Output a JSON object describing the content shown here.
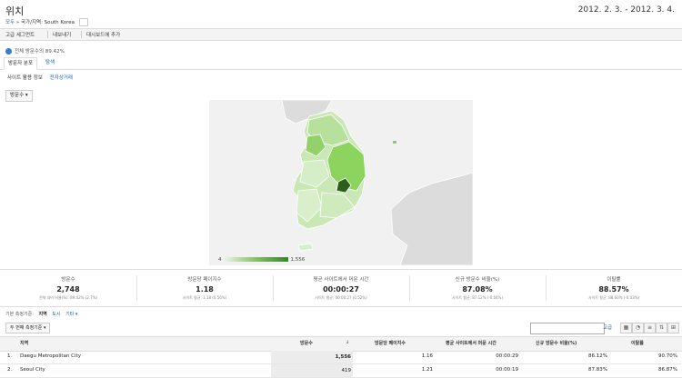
{
  "header": {
    "title": "위치",
    "date_range": "2012. 2. 3. - 2012. 3. 4."
  },
  "breadcrumb": {
    "root": "모두",
    "current": "» 국가/지역: South Korea"
  },
  "toolbar": {
    "advanced_segment": "고급 세그먼트",
    "email": "내보내기",
    "add_dashboard": "대시보드에 추가"
  },
  "segment": {
    "label": "전체 방문수의 89.42%"
  },
  "tabs": {
    "visitor_flow": "방문자 분포",
    "map_overlay": "탐색"
  },
  "subtabs": {
    "site_usage": "사이트 활용 정보",
    "goals": "전자상거래"
  },
  "metric_selector": {
    "value": "방문수"
  },
  "map_legend": {
    "min": "4",
    "max": "1,556"
  },
  "colors": {
    "map_dark": "#2d7a1c",
    "map_mid": "#8ccf63",
    "map_light": "#d9efcc",
    "link": "#1a63b8"
  },
  "metrics": [
    {
      "label": "방문수",
      "value": "2,748",
      "sub": "전체 대비 비율(%): 89.42% (2,7%)"
    },
    {
      "label": "방문당 페이지수",
      "value": "1.18",
      "sub": "사이트 평균: 1.18 (0.56%)"
    },
    {
      "label": "평균 사이트에서 머문 시간",
      "value": "00:00:27",
      "sub": "사이트 평균: 00:00:27 (0.52%)"
    },
    {
      "label": "신규 방문수 비율(%)",
      "value": "87.08%",
      "sub": "사이트 평균: 87.12% (-0.04%)"
    },
    {
      "label": "이탈률",
      "value": "88.57%",
      "sub": "사이트 평균: 88.60% (-0.03%)"
    }
  ],
  "view_controls": {
    "label": "기본 측정기준:",
    "region": "지역",
    "city": "도시",
    "other": "기타 ▾"
  },
  "secondary_dimension": {
    "label": "두 번째 측정기준 ▾"
  },
  "search": {
    "advanced": "고급"
  },
  "table": {
    "headers": [
      "지역",
      "방문수",
      "방문당 페이지수",
      "평균 사이트에서 머문 시간",
      "신규 방문수 비율(%)",
      "이탈률"
    ],
    "rows": [
      {
        "idx": "1.",
        "name": "Daegu Metropolitan City",
        "visits": "1,556",
        "ppv": "1.16",
        "time": "00:00:29",
        "new": "86.12%",
        "bounce": "90.70%"
      },
      {
        "idx": "2.",
        "name": "Seoul City",
        "visits": "419",
        "ppv": "1.21",
        "time": "00:00:19",
        "new": "87.83%",
        "bounce": "86.87%"
      }
    ]
  }
}
